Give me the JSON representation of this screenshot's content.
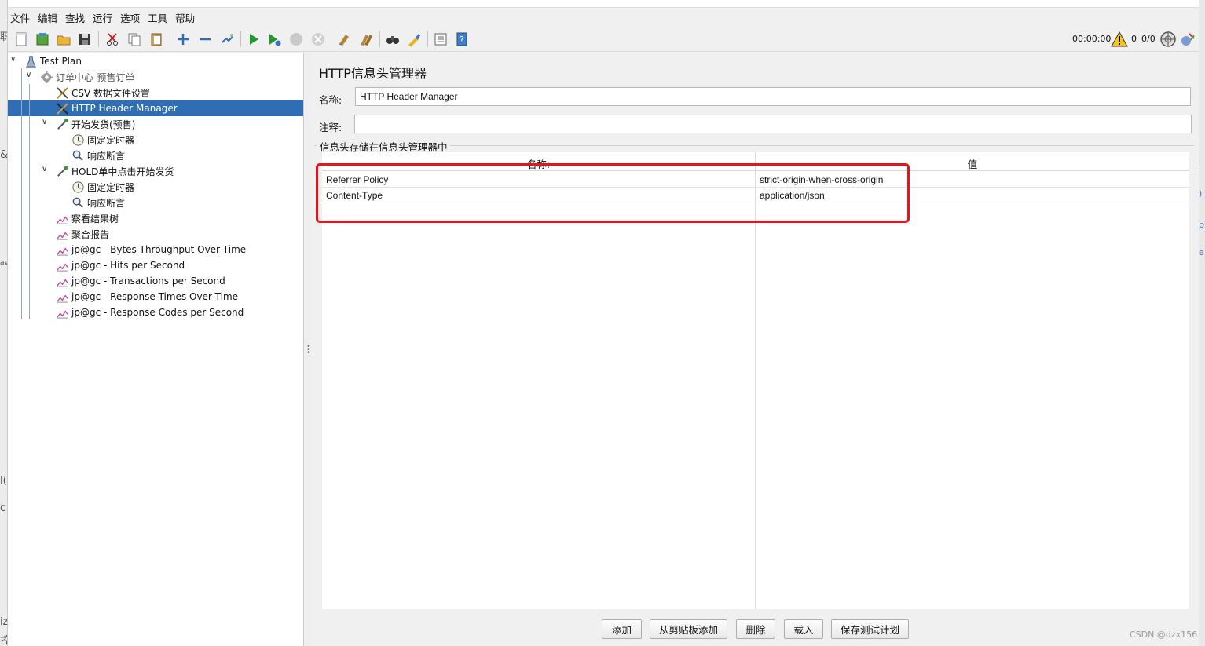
{
  "menu": [
    "文件",
    "编辑",
    "查找",
    "运行",
    "选项",
    "工具",
    "帮助"
  ],
  "toolbar": {
    "timer": "00:00:00",
    "warning_count": "0",
    "threads": "0/0"
  },
  "tree": {
    "items": [
      {
        "label": "Test Plan",
        "icon": "flask-icon"
      },
      {
        "label": "订单中心-预售订单",
        "icon": "gear-icon"
      },
      {
        "label": "CSV 数据文件设置",
        "icon": "wrench-icon"
      },
      {
        "label": "HTTP Header Manager",
        "icon": "wrench-icon"
      },
      {
        "label": "开始发货(预售)",
        "icon": "pipette-icon"
      },
      {
        "label": "固定定时器",
        "icon": "clock-icon"
      },
      {
        "label": "响应断言",
        "icon": "magnifier-icon"
      },
      {
        "label": "HOLD单中点击开始发货",
        "icon": "pipette-icon"
      },
      {
        "label": "固定定时器",
        "icon": "clock-icon"
      },
      {
        "label": "响应断言",
        "icon": "magnifier-icon"
      },
      {
        "label": "察看结果树",
        "icon": "chart-icon"
      },
      {
        "label": "聚合报告",
        "icon": "chart-icon"
      },
      {
        "label": "jp@gc - Bytes Throughput Over Time",
        "icon": "chart-icon"
      },
      {
        "label": "jp@gc - Hits per Second",
        "icon": "chart-icon"
      },
      {
        "label": "jp@gc - Transactions per Second",
        "icon": "chart-icon"
      },
      {
        "label": "jp@gc - Response Times Over Time",
        "icon": "chart-icon"
      },
      {
        "label": "jp@gc - Response Codes per Second",
        "icon": "chart-icon"
      }
    ]
  },
  "panel": {
    "title": "HTTP信息头管理器",
    "name_label": "名称:",
    "name_value": "HTTP Header Manager",
    "comment_label": "注释:",
    "comment_value": "",
    "group_label": "信息头存储在信息头管理器中",
    "columns": [
      "名称:",
      "值"
    ],
    "rows": [
      {
        "name": "Referrer Policy",
        "value": "strict-origin-when-cross-origin"
      },
      {
        "name": "Content-Type",
        "value": "application/json"
      }
    ]
  },
  "buttons": [
    "添加",
    "从剪贴板添加",
    "删除",
    "载入",
    "保存测试计划"
  ],
  "watermark": "CSDN @dzx156",
  "colors": {
    "selection": "#2f6db5",
    "highlight_box": "#e8141b"
  }
}
